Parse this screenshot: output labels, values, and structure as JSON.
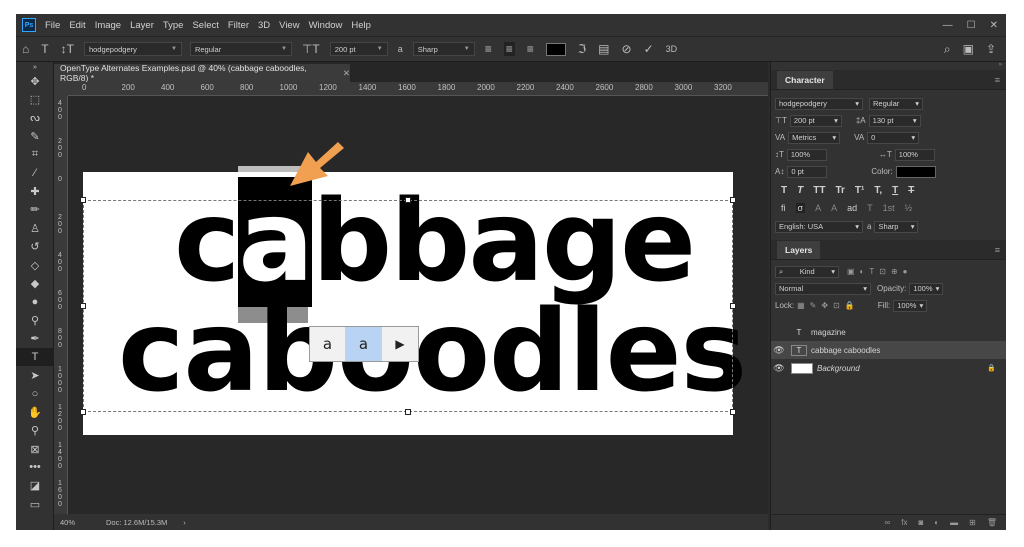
{
  "menu": [
    "File",
    "Edit",
    "Image",
    "Layer",
    "Type",
    "Select",
    "Filter",
    "3D",
    "View",
    "Window",
    "Help"
  ],
  "app_logo": "Ps",
  "options": {
    "font_family": "hodgepodgery",
    "font_style": "Regular",
    "font_size": "200 pt",
    "aa_label": "a",
    "antialias": "Sharp",
    "threed_label": "3D"
  },
  "doc": {
    "tab_title": "OpenType Alternates Examples.psd @ 40% (cabbage caboodles, RGB/8) *",
    "zoom": "40%",
    "doc_size": "Doc: 12.6M/15.3M",
    "ruler_ticks": [
      "0",
      "200",
      "400",
      "600",
      "800",
      "1000",
      "1200",
      "1400",
      "1600",
      "1800",
      "2000",
      "2200",
      "2400",
      "2600",
      "2800",
      "3000",
      "3200"
    ],
    "vruler_ticks": [
      "4\n0\n0",
      "2\n0\n0",
      "0",
      "2\n0\n0",
      "4\n0\n0",
      "6\n0\n0",
      "8\n0\n0",
      "1\n0\n0\n0",
      "1\n2\n0\n0",
      "1\n4\n0\n0",
      "1\n6\n0\n0"
    ]
  },
  "canvas": {
    "line1_pre": "c",
    "line1_sel": "a",
    "line1_post": "bbage",
    "line2": "caboodles",
    "alternates": [
      "a",
      "a"
    ],
    "more_glyph": "▶"
  },
  "character": {
    "tab": "Character",
    "font_family": "hodgepodgery",
    "font_style": "Regular",
    "size": "200 pt",
    "leading": "130 pt",
    "kerning": "Metrics",
    "tracking": "0",
    "vscale": "100%",
    "hscale": "100%",
    "baseline": "0 pt",
    "color_label": "Color:",
    "language": "English: USA",
    "aa_label": "a",
    "antialias": "Sharp",
    "style_glyphs": [
      "T",
      "T",
      "TT",
      "Tr",
      "T¹",
      "T,",
      "T",
      "T"
    ],
    "ot_glyphs": [
      "fi",
      "σ",
      "A",
      "A",
      "ad",
      "T",
      "1st",
      "½"
    ]
  },
  "layers": {
    "tab": "Layers",
    "kind": "Kind",
    "blend": "Normal",
    "opacity_label": "Opacity:",
    "opacity": "100%",
    "lock_label": "Lock:",
    "fill_label": "Fill:",
    "fill": "100%",
    "items": [
      {
        "name": "magazine",
        "type": "T",
        "visible": false
      },
      {
        "name": "cabbage caboodles",
        "type": "T",
        "visible": true
      },
      {
        "name": "Background",
        "type": "",
        "visible": true
      }
    ],
    "lock_icon": "🔒"
  },
  "colors": {
    "annotation_arrow": "#f0a050",
    "selection_highlight": "#b9d3f4"
  }
}
